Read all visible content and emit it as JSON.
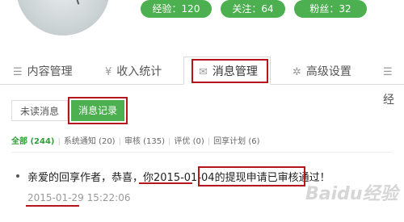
{
  "profile": {
    "stats": [
      {
        "label": "经验：120"
      },
      {
        "label": "关注：64"
      },
      {
        "label": "粉丝：32"
      }
    ]
  },
  "tabs": [
    {
      "icon": "list-icon",
      "glyph": "☰",
      "label": "内容管理"
    },
    {
      "icon": "yen-icon",
      "glyph": "¥",
      "label": "收入统计"
    },
    {
      "icon": "envelope-icon",
      "glyph": "✉",
      "label": "消息管理"
    },
    {
      "icon": "gear-icon",
      "glyph": "✲",
      "label": "高级设置"
    },
    {
      "icon": "extra-icon",
      "glyph": "☰",
      "label": "经"
    }
  ],
  "subtabs": {
    "unread": "未读消息",
    "history": "消息记录"
  },
  "filters": [
    {
      "label": "全部 (244)",
      "active": true
    },
    {
      "label": "系统通知 (20)"
    },
    {
      "label": "审核 (135)"
    },
    {
      "label": "评优 (0)"
    },
    {
      "label": "回享计划 (6)"
    }
  ],
  "message": {
    "prefix": "亲爱的回享作者，恭喜，你",
    "date_highlight": "2015-01-04",
    "middle": "的",
    "highlight": "提现申请已审核通过！",
    "time_date": "2015-01-29",
    "time_clock": " 15:22:06"
  },
  "watermark": "Baidu经验",
  "colors": {
    "accent": "#4caf50",
    "annotation": "#b5161b",
    "active_filter": "#2e9e3a"
  }
}
